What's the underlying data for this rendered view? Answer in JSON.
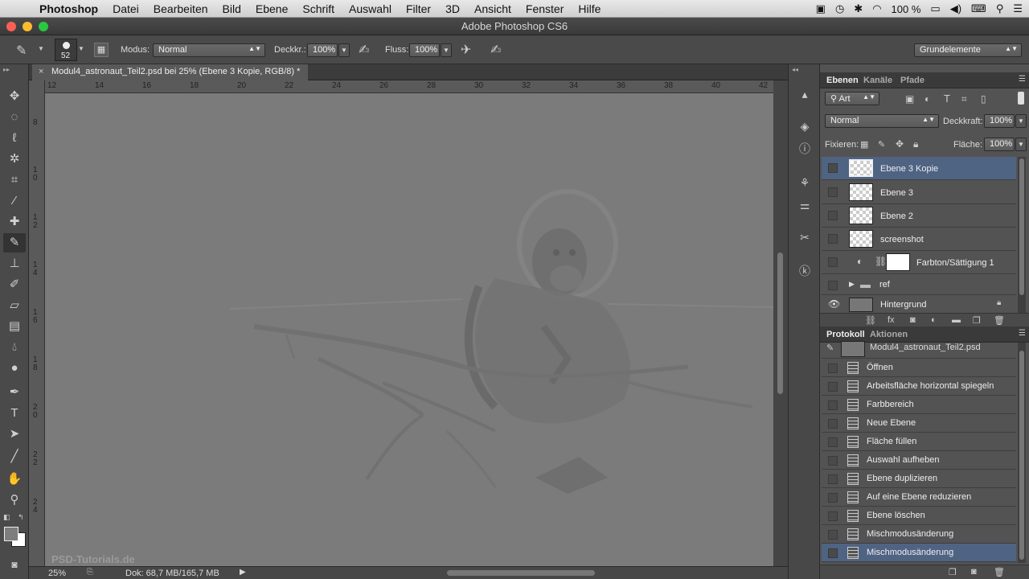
{
  "menubar": {
    "app": "Photoshop",
    "items": [
      "Datei",
      "Bearbeiten",
      "Bild",
      "Ebene",
      "Schrift",
      "Auswahl",
      "Filter",
      "3D",
      "Ansicht",
      "Fenster",
      "Hilfe"
    ],
    "battery": "100 %"
  },
  "window": {
    "title": "Adobe Photoshop CS6"
  },
  "options": {
    "brush_size": "52",
    "mode_label": "Modus:",
    "mode_value": "Normal",
    "opacity_label": "Deckkr.:",
    "opacity_value": "100%",
    "flow_label": "Fluss:",
    "flow_value": "100%",
    "workspace": "Grundelemente"
  },
  "document": {
    "tab_title": "Modul4_astronaut_Teil2.psd bei 25% (Ebene 3 Kopie, RGB/8) *",
    "ruler_top": [
      "12",
      "14",
      "16",
      "18",
      "20",
      "22",
      "24",
      "26",
      "28",
      "30",
      "32",
      "34",
      "36",
      "38",
      "40",
      "42"
    ],
    "ruler_left": [
      "8",
      "1 0",
      "1 2",
      "1 4",
      "1 6",
      "1 8",
      "2 0",
      "2 2",
      "2 4"
    ],
    "watermark": "PSD-Tutorials.de",
    "zoom": "25%",
    "doc_size": "Dok: 68,7 MB/165,7 MB"
  },
  "layers_panel": {
    "tabs": [
      "Ebenen",
      "Kanäle",
      "Pfade"
    ],
    "filter_kind": "Art",
    "blend_mode": "Normal",
    "opacity_label": "Deckkraft:",
    "opacity_value": "100%",
    "lock_label": "Fixieren:",
    "fill_label": "Fläche:",
    "fill_value": "100%",
    "layers": [
      {
        "name": "Ebene 3 Kopie",
        "selected": true
      },
      {
        "name": "Ebene 3"
      },
      {
        "name": "Ebene 2"
      },
      {
        "name": "screenshot"
      },
      {
        "name": "Farbton/Sättigung 1"
      },
      {
        "name": "ref"
      },
      {
        "name": "Hintergrund"
      }
    ]
  },
  "history_panel": {
    "tabs": [
      "Protokoll",
      "Aktionen"
    ],
    "snapshot": "Modul4_astronaut_Teil2.psd",
    "items": [
      "Öffnen",
      "Arbeitsfläche horizontal spiegeln",
      "Farbbereich",
      "Neue Ebene",
      "Fläche füllen",
      "Auswahl aufheben",
      "Ebene duplizieren",
      "Auf eine Ebene reduzieren",
      "Ebene löschen",
      "Mischmodusänderung",
      "Mischmodusänderung"
    ]
  }
}
